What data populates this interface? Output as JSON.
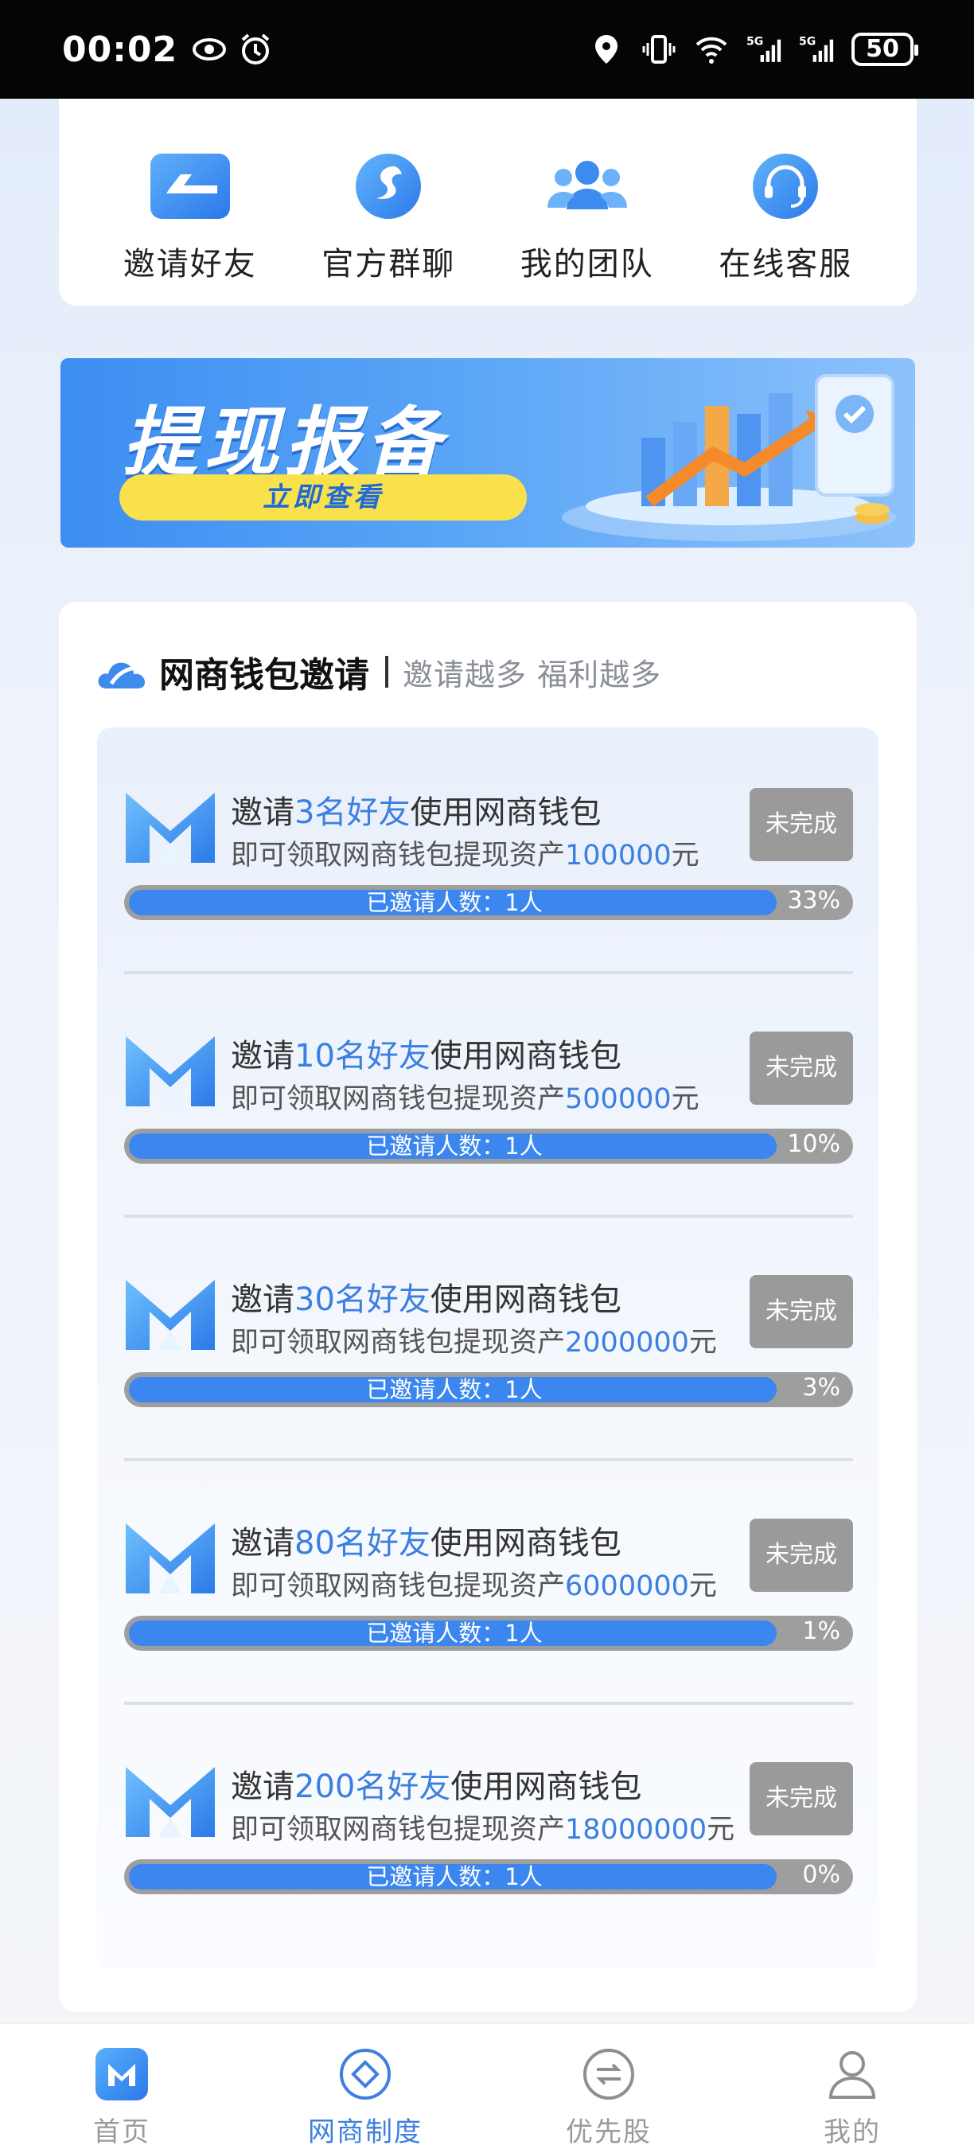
{
  "status_bar": {
    "time": "00:02",
    "battery": "50"
  },
  "quick_actions": [
    {
      "label": "邀请好友",
      "icon": "invite-icon"
    },
    {
      "label": "官方群聊",
      "icon": "group-chat-icon"
    },
    {
      "label": "我的团队",
      "icon": "team-icon"
    },
    {
      "label": "在线客服",
      "icon": "headset-icon"
    }
  ],
  "banner": {
    "title": "提现报备",
    "cta": "立即查看"
  },
  "invite": {
    "title": "网商钱包邀请",
    "subtitle": "邀请越多 福利越多",
    "tasks": [
      {
        "pre": "邀请",
        "count": "3名好友",
        "post": "使用网商钱包",
        "desc": "即可领取网商钱包提现资产",
        "amount": "100000",
        "unit": "元",
        "status": "未完成",
        "progress_text": "已邀请人数：1人",
        "percent": "33%"
      },
      {
        "pre": "邀请",
        "count": "10名好友",
        "post": "使用网商钱包",
        "desc": "即可领取网商钱包提现资产",
        "amount": "500000",
        "unit": "元",
        "status": "未完成",
        "progress_text": "已邀请人数：1人",
        "percent": "10%"
      },
      {
        "pre": "邀请",
        "count": "30名好友",
        "post": "使用网商钱包",
        "desc": "即可领取网商钱包提现资产",
        "amount": "2000000",
        "unit": "元",
        "status": "未完成",
        "progress_text": "已邀请人数：1人",
        "percent": "3%"
      },
      {
        "pre": "邀请",
        "count": "80名好友",
        "post": "使用网商钱包",
        "desc": "即可领取网商钱包提现资产",
        "amount": "6000000",
        "unit": "元",
        "status": "未完成",
        "progress_text": "已邀请人数：1人",
        "percent": "1%"
      },
      {
        "pre": "邀请",
        "count": "200名好友",
        "post": "使用网商钱包",
        "desc": "即可领取网商钱包提现资产",
        "amount": "18000000",
        "unit": "元",
        "status": "未完成",
        "progress_text": "已邀请人数：1人",
        "percent": "0%"
      }
    ]
  },
  "tabbar": [
    {
      "label": "首页",
      "icon": "home-icon"
    },
    {
      "label": "网商制度",
      "icon": "policy-icon",
      "active": true
    },
    {
      "label": "优先股",
      "icon": "equity-icon"
    },
    {
      "label": "我的",
      "icon": "profile-icon"
    }
  ],
  "colors": {
    "accent": "#3b87ef",
    "highlight_text": "#3b7fe0",
    "badge": "#9a9a9a",
    "cta_yellow": "#f9e14b"
  }
}
